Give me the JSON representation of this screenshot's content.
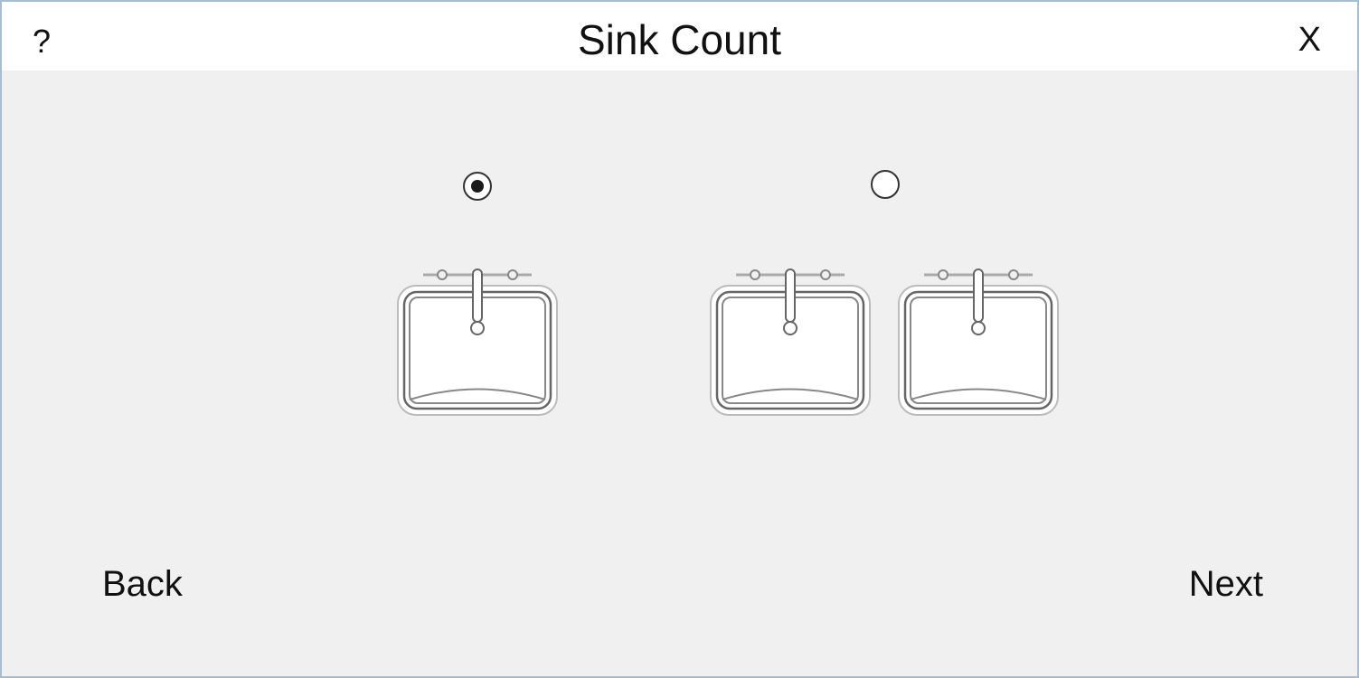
{
  "window": {
    "title": "Sink Count",
    "help_label": "?",
    "close_label": "X"
  },
  "options": [
    {
      "sinks": 1,
      "selected": true
    },
    {
      "sinks": 2,
      "selected": false
    }
  ],
  "navigation": {
    "back_label": "Back",
    "next_label": "Next"
  },
  "icons": {
    "sink": "sink-icon"
  }
}
